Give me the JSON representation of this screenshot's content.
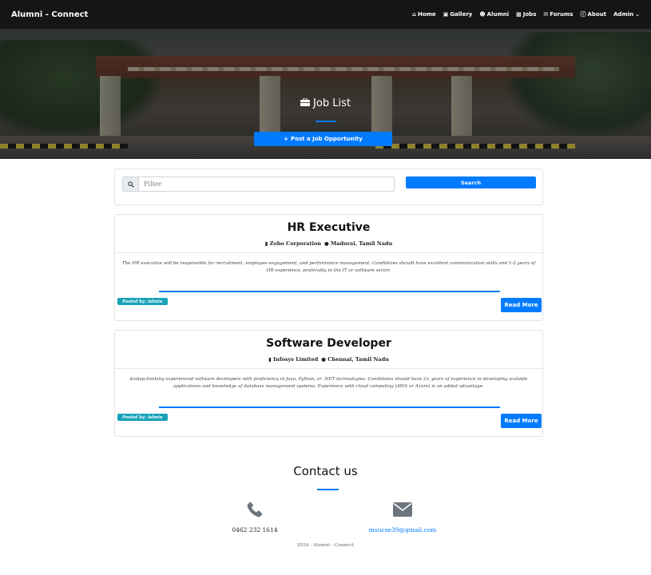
{
  "navbar": {
    "brand": "Alumni - Connect",
    "links": [
      {
        "label": "Home",
        "icon": "home-icon"
      },
      {
        "label": "Gallery",
        "icon": "images-icon"
      },
      {
        "label": "Alumni",
        "icon": "users-icon"
      },
      {
        "label": "Jobs",
        "icon": "briefcase-icon"
      },
      {
        "label": "Forums",
        "icon": "comments-icon"
      },
      {
        "label": "About",
        "icon": "info-icon"
      },
      {
        "label": "Admin",
        "icon": "chevron-down-icon"
      }
    ]
  },
  "hero": {
    "title": "Job List",
    "post_button": "Post a Job Opportunity"
  },
  "filter": {
    "placeholder": "Filter",
    "search_button": "Search"
  },
  "jobs": [
    {
      "title": "HR Executive",
      "company": "Zoho Corporation",
      "location": "Madurai, Tamil Nadu",
      "description": "The HR executive will be responsible for recruitment, employee engagement, and performance management. Candidates should have excellent communication skills and 1-3 years of HR experience, preferably in the IT or software sector.",
      "posted_by": "Posted by: Admin",
      "read_more": "Read More"
    },
    {
      "title": "Software Developer",
      "company": "Infosys Limited",
      "location": "Chennai, Tamil Nadu",
      "description": "&nbsp;Seeking experienced software developers with proficiency in Java, Python, or .NET technologies. Candidates should have 2+ years of experience in developing scalable applications and knowledge of database management systems. Experience with cloud computing (AWS or Azure) is an added advantage.",
      "posted_by": "Posted by: Admin",
      "read_more": "Read More"
    }
  ],
  "contact": {
    "title": "Contact us",
    "phone": "0462 232 1614",
    "email": "msucse39@gmail.com",
    "phone_icon": "phone-icon",
    "email_icon": "envelope-icon"
  },
  "footer": {
    "text": "2024 - Alumni - Connect"
  },
  "colors": {
    "primary": "#007bff",
    "badge": "#17a2b8",
    "navbar": "#141414"
  }
}
